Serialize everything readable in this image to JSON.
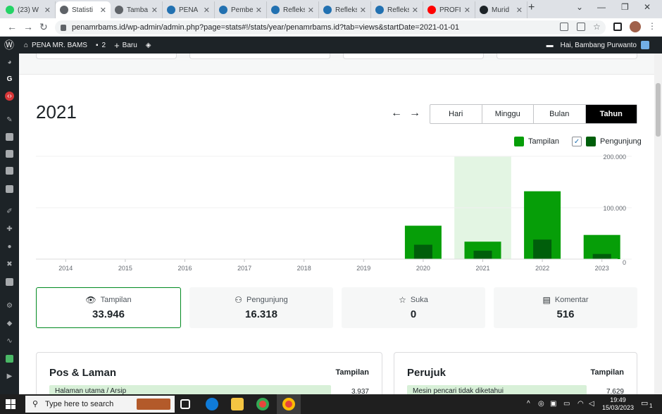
{
  "browser": {
    "tabs": [
      {
        "label": "(23) W",
        "color": "#25d366",
        "active": false
      },
      {
        "label": "Statisti",
        "color": "#5f6368",
        "active": true
      },
      {
        "label": "Tamba",
        "color": "#5f6368",
        "active": false
      },
      {
        "label": "PENA",
        "color": "#2271b1",
        "active": false
      },
      {
        "label": "Pembe",
        "color": "#2271b1",
        "active": false
      },
      {
        "label": "Refleks",
        "color": "#2271b1",
        "active": false
      },
      {
        "label": "Refleks",
        "color": "#2271b1",
        "active": false
      },
      {
        "label": "Refleks",
        "color": "#2271b1",
        "active": false
      },
      {
        "label": "PROFI",
        "color": "#ff0000",
        "active": false
      },
      {
        "label": "Murid",
        "color": "#1d2327",
        "active": false
      }
    ],
    "url": "penamrbams.id/wp-admin/admin.php?page=stats#!/stats/year/penamrbams.id?tab=views&startDate=2021-01-01"
  },
  "adminbar": {
    "site_name": "PENA MR. BAMS",
    "comments_count": "2",
    "new_label": "Baru",
    "greeting": "Hai, Bambang Purwanto"
  },
  "stats": {
    "period_title": "2021",
    "period_buttons": [
      {
        "label": "Hari",
        "selected": false
      },
      {
        "label": "Minggu",
        "selected": false
      },
      {
        "label": "Bulan",
        "selected": false
      },
      {
        "label": "Tahun",
        "selected": true
      }
    ],
    "legend": {
      "views_label": "Tampilan",
      "visitors_label": "Pengunjung"
    },
    "colors": {
      "views": "#069e08",
      "visitors": "#005e0b",
      "highlight": "#e3f5e3"
    },
    "cards": [
      {
        "icon": "eye-icon",
        "label": "Tampilan",
        "value": "33.946",
        "selected": true
      },
      {
        "icon": "people-icon",
        "label": "Pengunjung",
        "value": "16.318",
        "selected": false
      },
      {
        "icon": "star-icon",
        "label": "Suka",
        "value": "0",
        "selected": false
      },
      {
        "icon": "comment-icon",
        "label": "Komentar",
        "value": "516",
        "selected": false
      }
    ],
    "panels": [
      {
        "title": "Pos & Laman",
        "header": "Tampilan",
        "row_label": "Halaman utama / Arsip",
        "row_value": "3.937"
      },
      {
        "title": "Perujuk",
        "header": "Tampilan",
        "row_label": "Mesin pencari tidak diketahui",
        "row_value": "7.629"
      }
    ]
  },
  "chart_data": {
    "type": "bar",
    "categories": [
      "2014",
      "2015",
      "2016",
      "2017",
      "2018",
      "2019",
      "2020",
      "2021",
      "2022",
      "2023"
    ],
    "series": [
      {
        "name": "Tampilan",
        "values": [
          0,
          0,
          0,
          0,
          0,
          0,
          65000,
          33946,
          132000,
          47000
        ]
      },
      {
        "name": "Pengunjung",
        "values": [
          0,
          0,
          0,
          0,
          0,
          0,
          28000,
          16318,
          38000,
          10000
        ]
      }
    ],
    "y_ticks": [
      "0",
      "100.000",
      "200.000"
    ],
    "ylim": [
      0,
      200000
    ],
    "highlighted_category": "2021",
    "legend": "top-right",
    "grid": true
  },
  "taskbar": {
    "search_placeholder": "Type here to search",
    "time": "19:49",
    "date": "15/03/2023",
    "notif_count": "1"
  }
}
